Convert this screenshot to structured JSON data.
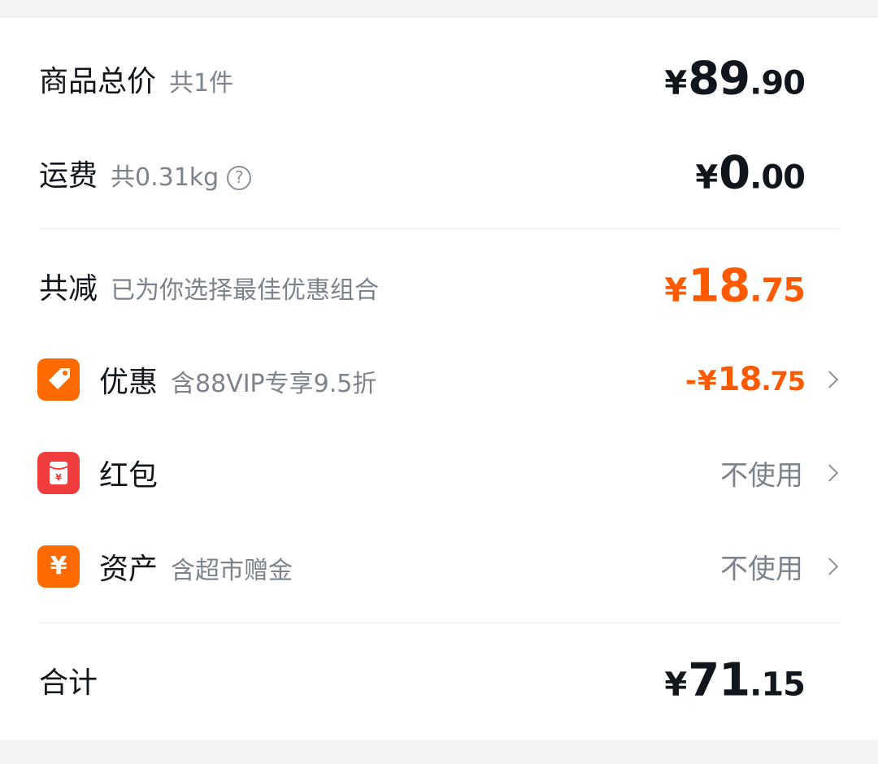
{
  "summary": {
    "goods_total": {
      "label": "商品总价",
      "sub": "共1件",
      "currency": "¥",
      "integer": "89",
      "decimal": ".90"
    },
    "shipping": {
      "label": "运费",
      "sub": "共0.31kg",
      "help_icon": "?",
      "currency": "¥",
      "integer": "0",
      "decimal": ".00"
    },
    "total_discount": {
      "label": "共减",
      "sub": "已为你选择最佳优惠组合",
      "currency": "¥",
      "integer": "18",
      "decimal": ".75",
      "color": "#ff5a00"
    },
    "items": [
      {
        "icon": "coupon-tag-icon",
        "label": "优惠",
        "sub": "含88VIP专享9.5折",
        "prefix": "-",
        "currency": "¥",
        "integer": "18",
        "decimal": ".75"
      },
      {
        "icon": "red-packet-icon",
        "label": "红包",
        "sub": "",
        "value": "不使用"
      },
      {
        "icon": "assets-yen-icon",
        "label": "资产",
        "sub": "含超市赠金",
        "value": "不使用",
        "icon_glyph": "¥"
      }
    ],
    "grand_total": {
      "label": "合计",
      "currency": "¥",
      "integer": "71",
      "decimal": ".15"
    }
  },
  "colors": {
    "accent_orange": "#ff5a00",
    "red_packet": "#f03c3c",
    "icon_orange": "#ff6a00"
  }
}
